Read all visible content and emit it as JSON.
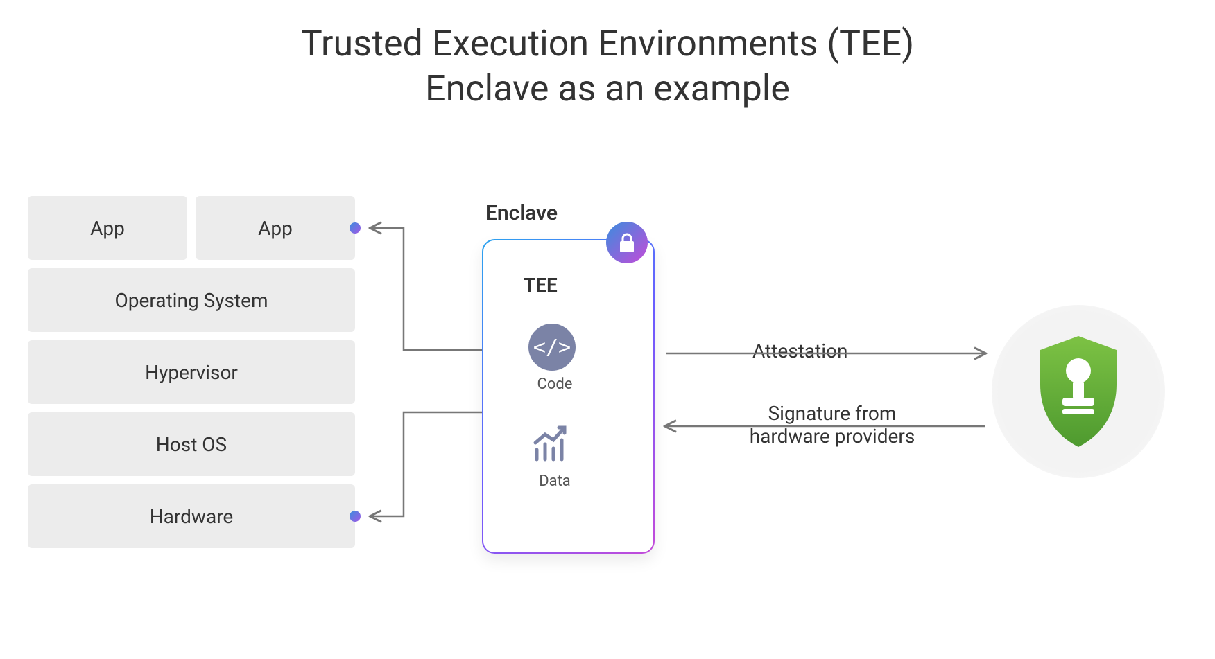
{
  "title_line1": "Trusted Execution Environments (TEE)",
  "title_line2": "Enclave as an example",
  "stack": {
    "app1": "App",
    "app2": "App",
    "os": "Operating System",
    "hypervisor": "Hypervisor",
    "host_os": "Host OS",
    "hardware": "Hardware"
  },
  "enclave": {
    "label": "Enclave",
    "tee": "TEE",
    "code": "Code",
    "data": "Data"
  },
  "arrows": {
    "attestation": "Attestation",
    "signature_line1": "Signature from",
    "signature_line2": "hardware providers"
  }
}
